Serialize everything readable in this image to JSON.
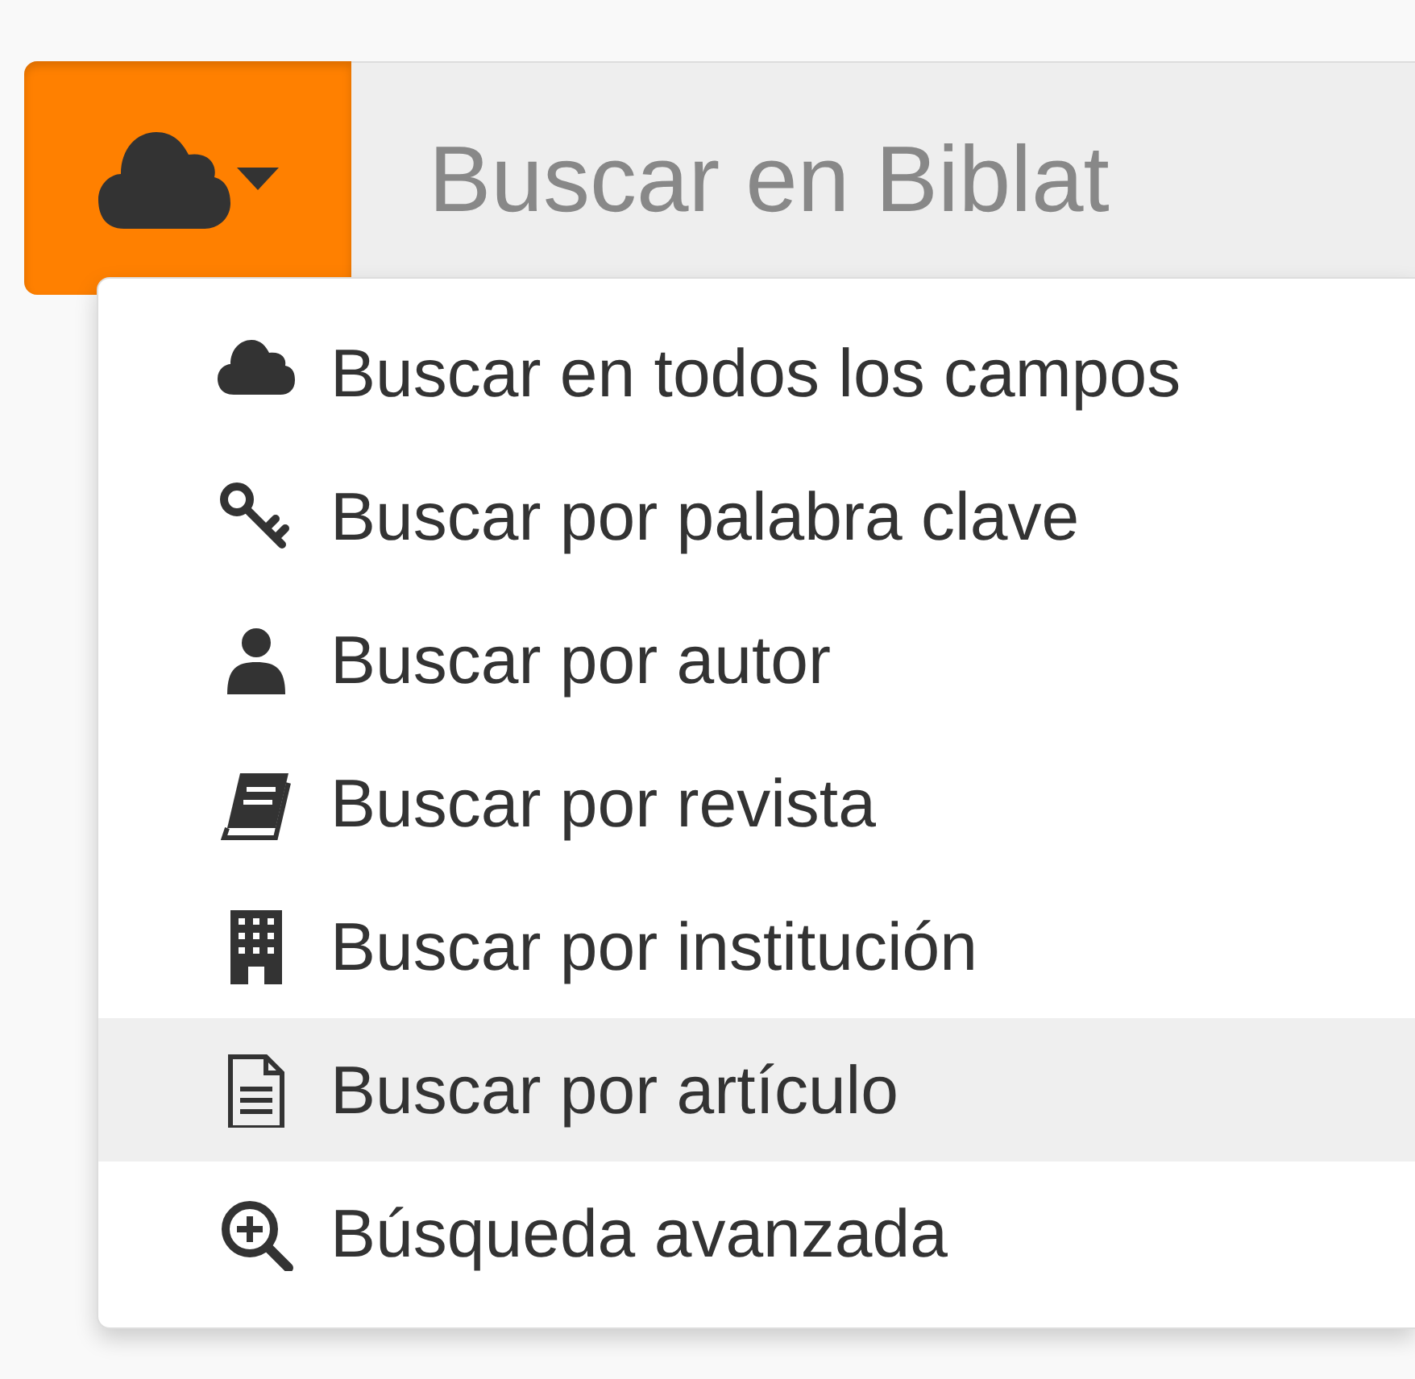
{
  "search": {
    "placeholder": "Buscar en Biblat"
  },
  "menu": [
    {
      "kind": "cloud",
      "label": "Buscar en todos los campos",
      "selected": false
    },
    {
      "kind": "key",
      "label": "Buscar por palabra clave",
      "selected": false
    },
    {
      "kind": "user",
      "label": "Buscar por autor",
      "selected": false
    },
    {
      "kind": "book",
      "label": "Buscar por revista",
      "selected": false
    },
    {
      "kind": "building",
      "label": "Buscar por institución",
      "selected": false
    },
    {
      "kind": "file",
      "label": "Buscar por artículo",
      "selected": true
    },
    {
      "kind": "zoom",
      "label": "Búsqueda avanzada",
      "selected": false
    }
  ]
}
